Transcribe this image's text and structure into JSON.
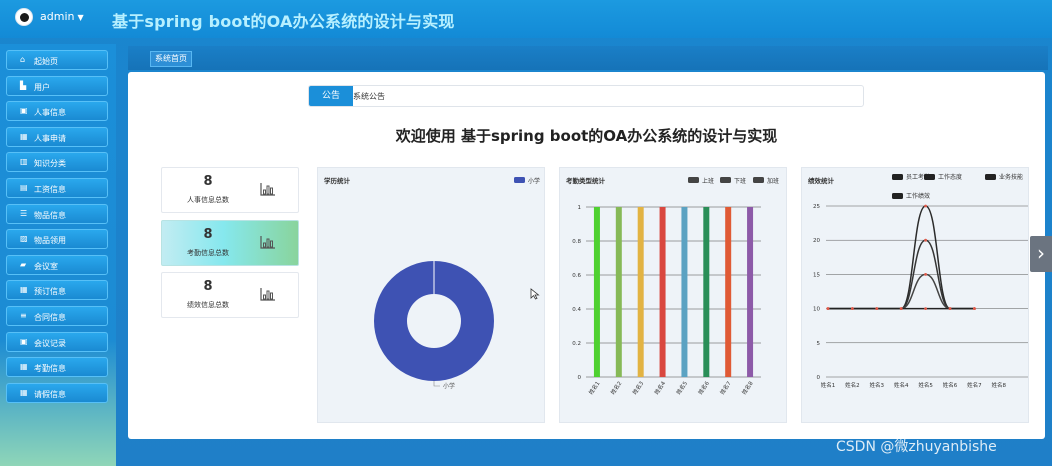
{
  "header": {
    "username": "admin",
    "title": "基于spring boot的OA办公系统的设计与实现"
  },
  "sidebar": {
    "items": [
      {
        "label": "起始页",
        "icon": "home-icon"
      },
      {
        "label": "用户",
        "icon": "user-icon"
      },
      {
        "label": "人事信息",
        "icon": "chat-icon"
      },
      {
        "label": "人事申请",
        "icon": "grid-icon"
      },
      {
        "label": "知识分类",
        "icon": "book-icon"
      },
      {
        "label": "工资信息",
        "icon": "document-icon"
      },
      {
        "label": "物品信息",
        "icon": "sliders-icon"
      },
      {
        "label": "物品领用",
        "icon": "chart-icon"
      },
      {
        "label": "会议室",
        "icon": "ticket-icon"
      },
      {
        "label": "预订信息",
        "icon": "calendar-icon"
      },
      {
        "label": "合同信息",
        "icon": "list-icon"
      },
      {
        "label": "会议记录",
        "icon": "badge-icon"
      },
      {
        "label": "考勤信息",
        "icon": "grid-icon"
      },
      {
        "label": "请假信息",
        "icon": "grid-icon"
      }
    ]
  },
  "breadcrumb": {
    "label": "系统首页"
  },
  "notice": {
    "tag": "公告",
    "text": "系统公告"
  },
  "welcome": "欢迎使用 基于spring boot的OA办公系统的设计与实现",
  "stats": [
    {
      "value": "8",
      "label": "人事信息总数"
    },
    {
      "value": "8",
      "label": "考勤信息总数"
    },
    {
      "value": "8",
      "label": "绩效信息总数"
    }
  ],
  "colors": {
    "accent": "#1b8fd9",
    "donut": "#3e52b3",
    "dark_series": "#333333",
    "red_point": "#e05a4a"
  },
  "chart_data": [
    {
      "type": "pie",
      "title": "学历统计",
      "legend": [
        "小学"
      ],
      "legend_position": "top-right",
      "slices": [
        {
          "name": "小学",
          "value": 1
        }
      ],
      "hole": true
    },
    {
      "type": "bar",
      "title": "考勤类型统计",
      "legend": [
        "上班",
        "下班",
        "加班"
      ],
      "legend_position": "top-right",
      "categories": [
        "姓名1",
        "姓名2",
        "姓名3",
        "姓名4",
        "姓名5",
        "姓名6",
        "姓名7",
        "姓名8"
      ],
      "values": [
        1,
        1,
        1,
        1,
        1,
        1,
        1,
        1
      ],
      "bar_colors": [
        "#4fd131",
        "#86b957",
        "#e2b342",
        "#d9473f",
        "#5ba2c2",
        "#2a8e58",
        "#e05a35",
        "#8d5aa8"
      ],
      "ylim": [
        0,
        1
      ],
      "yticks": [
        0,
        0.2,
        0.4,
        0.6,
        0.8,
        1
      ],
      "grid": true
    },
    {
      "type": "line",
      "title": "绩效统计",
      "legend": [
        "员工考勤",
        "工作态度",
        "业务技能",
        "工作绩效"
      ],
      "legend_position": "top-right",
      "x": [
        "姓名1",
        "姓名2",
        "姓名3",
        "姓名4",
        "姓名5",
        "姓名6",
        "姓名7",
        "姓名8"
      ],
      "series": [
        {
          "name": "员工考勤",
          "values": [
            10,
            10,
            10,
            10,
            25,
            10,
            10,
            null
          ]
        },
        {
          "name": "工作态度",
          "values": [
            10,
            10,
            10,
            10,
            20,
            10,
            10,
            null
          ]
        },
        {
          "name": "业务技能",
          "values": [
            10,
            10,
            10,
            10,
            15,
            10,
            10,
            null
          ]
        },
        {
          "name": "工作绩效",
          "values": [
            10,
            10,
            10,
            10,
            10,
            10,
            10,
            null
          ]
        }
      ],
      "ylim": [
        0,
        25
      ],
      "yticks": [
        0,
        5,
        10,
        15,
        20,
        25
      ],
      "grid": true
    }
  ],
  "watermark": "CSDN @微zhuyanbishe"
}
